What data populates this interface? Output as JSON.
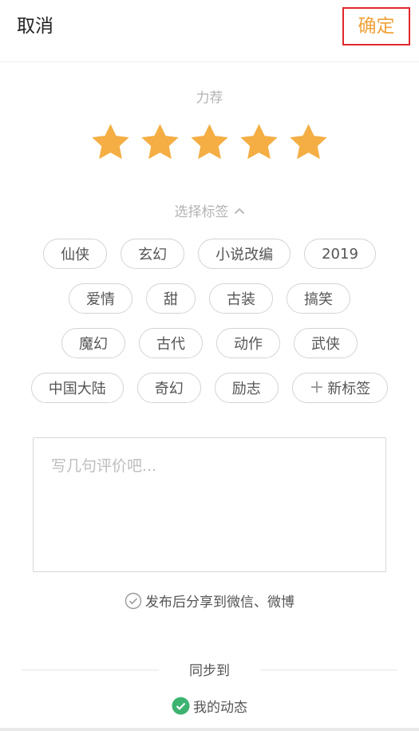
{
  "header": {
    "cancel_label": "取消",
    "confirm_label": "确定"
  },
  "rating": {
    "label": "力荐",
    "value": 5,
    "max": 5,
    "star_color": "#f4ae44"
  },
  "tags": {
    "toggle_label": "选择标签",
    "rows": [
      [
        "仙侠",
        "玄幻",
        "小说改编",
        "2019"
      ],
      [
        "爱情",
        "甜",
        "古装",
        "搞笑"
      ],
      [
        "魔幻",
        "古代",
        "动作",
        "武侠"
      ],
      [
        "中国大陆",
        "奇幻",
        "励志"
      ]
    ],
    "new_tag_label": "新标签"
  },
  "review": {
    "placeholder": "写几句评价吧...",
    "value": ""
  },
  "share": {
    "label": "发布后分享到微信、微博",
    "checked": false
  },
  "sync": {
    "label": "同步到",
    "feed_label": "我的动态",
    "feed_checked": true,
    "feed_color": "#3cb371"
  },
  "colors": {
    "accent": "#f0a23b",
    "highlight_border": "#e0282d"
  }
}
